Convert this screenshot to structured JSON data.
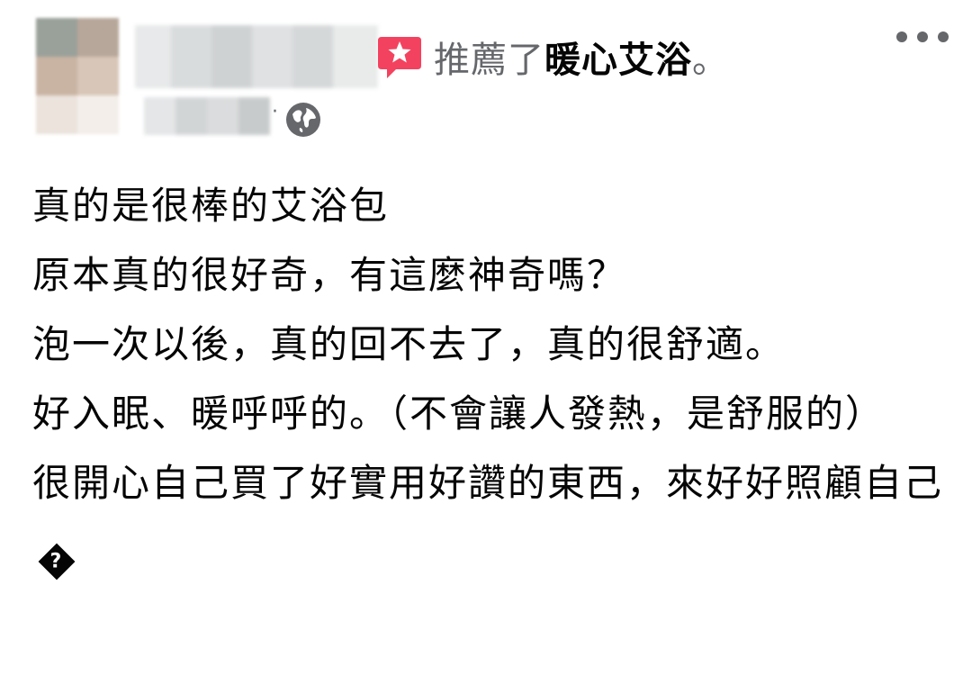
{
  "header": {
    "recommends_text": "推薦了",
    "page_name": "暖心艾浴",
    "period": "。",
    "more_icon": "more-horizontal-icon",
    "audience_icon": "globe-icon",
    "meta_separator": "·"
  },
  "colors": {
    "recommend_icon": "#f3425f",
    "secondary_text": "#65676b",
    "primary_text": "#050505"
  },
  "post": {
    "lines": [
      "真的是很棒的艾浴包",
      "原本真的很好奇，有這麼神奇嗎？",
      "泡一次以後，真的回不去了，真的很舒適。",
      "好入眠、暖呼呼的。（不會讓人發熱，是舒服的）",
      "很開心自己買了好實用好讚的東西，來好好照顧自己"
    ],
    "trailing_glyph": "?"
  }
}
